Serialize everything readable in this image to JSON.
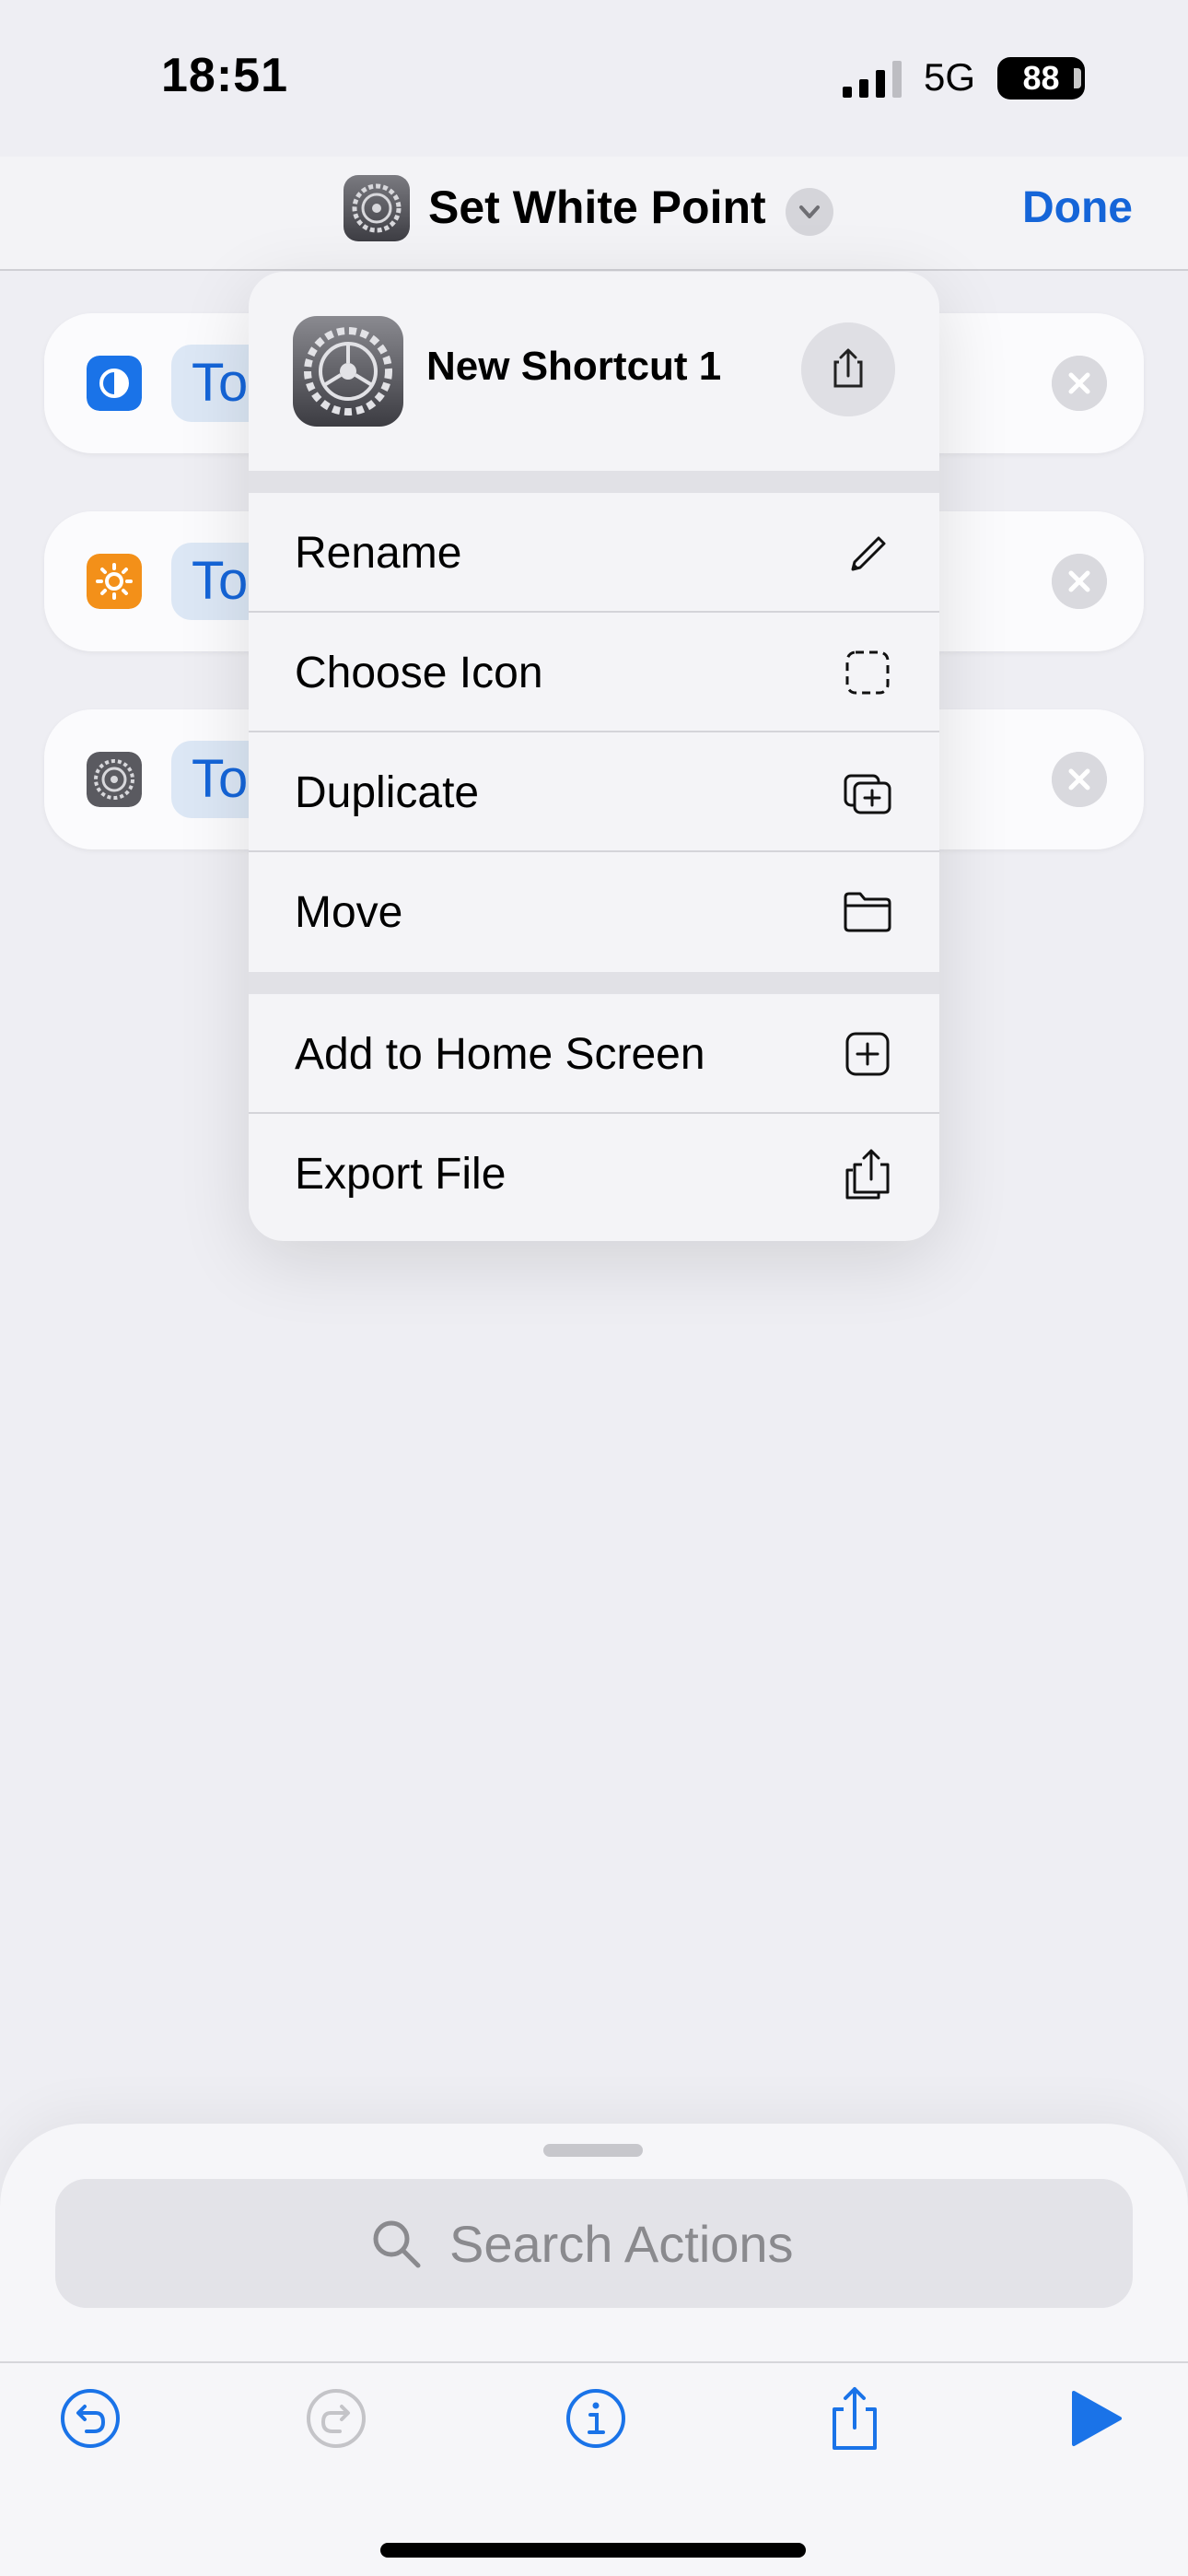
{
  "status_bar": {
    "time": "18:51",
    "network": "5G",
    "battery": "88"
  },
  "header": {
    "title": "Set White Point",
    "done_label": "Done"
  },
  "cards": [
    {
      "pill": "To",
      "icon": "dark-mode-icon",
      "icon_color": "#1A73E8"
    },
    {
      "pill": "To",
      "icon": "brightness-icon",
      "icon_color": "#F39019"
    },
    {
      "pill": "To",
      "icon": "settings-gear-icon",
      "icon_color": "#5A5A60"
    }
  ],
  "menu": {
    "shortcut_name": "New Shortcut 1",
    "items": [
      {
        "label": "Rename",
        "icon": "pencil-icon"
      },
      {
        "label": "Choose Icon",
        "icon": "dashed-square-icon"
      },
      {
        "label": "Duplicate",
        "icon": "duplicate-icon"
      },
      {
        "label": "Move",
        "icon": "folder-icon"
      },
      {
        "label": "Add to Home Screen",
        "icon": "plus-square-icon"
      },
      {
        "label": "Export File",
        "icon": "export-file-icon"
      }
    ]
  },
  "bottom_sheet": {
    "search_placeholder": "Search Actions"
  },
  "toolbar": [
    "undo-icon",
    "redo-icon",
    "info-icon",
    "share-icon",
    "play-icon"
  ],
  "colors": {
    "accent": "#1565D8",
    "background": "#EEEEF3"
  }
}
